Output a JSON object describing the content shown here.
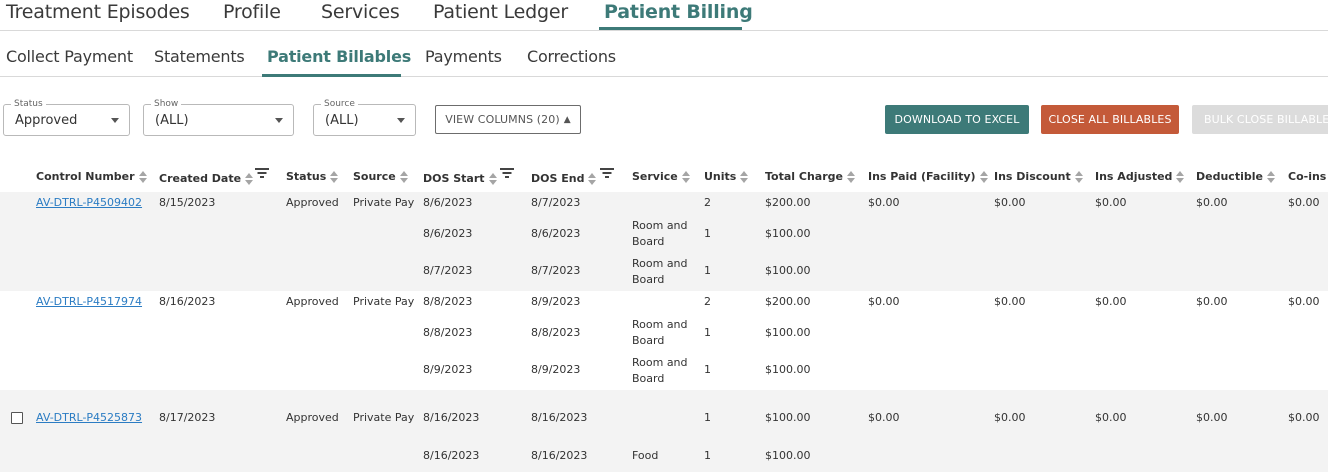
{
  "top_tabs": [
    "Treatment Episodes",
    "Profile",
    "Services",
    "Patient Ledger",
    "Patient Billing"
  ],
  "sub_tabs": [
    "Collect Payment",
    "Statements",
    "Patient Billables",
    "Payments",
    "Corrections"
  ],
  "filters": {
    "status": {
      "legend": "Status",
      "value": "Approved"
    },
    "show": {
      "legend": "Show",
      "value": "(ALL)"
    },
    "source": {
      "legend": "Source",
      "value": "(ALL)"
    }
  },
  "buttons": {
    "view_columns": "VIEW COLUMNS (20)",
    "view_columns_arrow": "▲",
    "download_excel": "DOWNLOAD TO EXCEL",
    "close_all": "CLOSE ALL BILLABLES",
    "bulk_close": "BULK CLOSE BILLABLES"
  },
  "columns": [
    "Control Number",
    "Created Date",
    "Status",
    "Source",
    "DOS Start",
    "DOS End",
    "Service",
    "Units",
    "Total Charge",
    "Ins Paid (Facility)",
    "Ins Discount",
    "Ins Adjusted",
    "Deductible",
    "Co-ins"
  ],
  "groups": [
    {
      "control_number": "AV-DTRL-P4509402",
      "created_date": "8/15/2023",
      "status": "Approved",
      "source": "Private Pay",
      "dos_start": "8/6/2023",
      "dos_end": "8/7/2023",
      "service": "",
      "units": "2",
      "total_charge": "$200.00",
      "ins_paid": "$0.00",
      "ins_discount": "$0.00",
      "ins_adjusted": "$0.00",
      "deductible": "$0.00",
      "coins": "$0.00",
      "details": [
        {
          "dos_start": "8/6/2023",
          "dos_end": "8/6/2023",
          "service": "Room and Board",
          "units": "1",
          "total_charge": "$100.00"
        },
        {
          "dos_start": "8/7/2023",
          "dos_end": "8/7/2023",
          "service": "Room and Board",
          "units": "1",
          "total_charge": "$100.00"
        }
      ]
    },
    {
      "control_number": "AV-DTRL-P4517974",
      "created_date": "8/16/2023",
      "status": "Approved",
      "source": "Private Pay",
      "dos_start": "8/8/2023",
      "dos_end": "8/9/2023",
      "service": "",
      "units": "2",
      "total_charge": "$200.00",
      "ins_paid": "$0.00",
      "ins_discount": "$0.00",
      "ins_adjusted": "$0.00",
      "deductible": "$0.00",
      "coins": "$0.00",
      "details": [
        {
          "dos_start": "8/8/2023",
          "dos_end": "8/8/2023",
          "service": "Room and Board",
          "units": "1",
          "total_charge": "$100.00"
        },
        {
          "dos_start": "8/9/2023",
          "dos_end": "8/9/2023",
          "service": "Room and Board",
          "units": "1",
          "total_charge": "$100.00"
        }
      ]
    },
    {
      "control_number": "AV-DTRL-P4525873",
      "created_date": "8/17/2023",
      "status": "Approved",
      "source": "Private Pay",
      "dos_start": "8/16/2023",
      "dos_end": "8/16/2023",
      "service": "",
      "units": "1",
      "total_charge": "$100.00",
      "ins_paid": "$0.00",
      "ins_discount": "$0.00",
      "ins_adjusted": "$0.00",
      "deductible": "$0.00",
      "coins": "$0.00",
      "details": [
        {
          "dos_start": "8/16/2023",
          "dos_end": "8/16/2023",
          "service": "Food",
          "units": "1",
          "total_charge": "$100.00"
        }
      ]
    }
  ]
}
